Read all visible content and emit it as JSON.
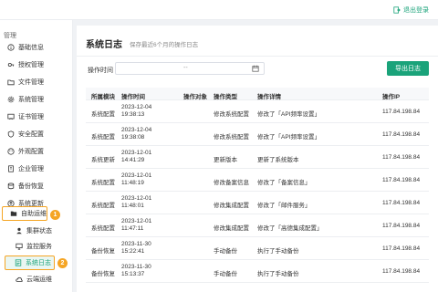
{
  "header": {
    "logout_label": "退出登录"
  },
  "sidebar": {
    "section_title": "管理",
    "items": [
      {
        "label": "基础信息",
        "icon": "info-icon"
      },
      {
        "label": "授权管理",
        "icon": "key-icon"
      },
      {
        "label": "文件管理",
        "icon": "folder-icon"
      },
      {
        "label": "系统管理",
        "icon": "gear-icon"
      },
      {
        "label": "证书管理",
        "icon": "certificate-icon"
      },
      {
        "label": "安全配置",
        "icon": "shield-icon"
      },
      {
        "label": "外观配置",
        "icon": "palette-icon"
      },
      {
        "label": "企业管理",
        "icon": "building-icon"
      },
      {
        "label": "备份恢复",
        "icon": "backup-icon"
      },
      {
        "label": "系统更新",
        "icon": "update-icon"
      },
      {
        "label": "自助运维",
        "icon": "folder-open-icon"
      }
    ],
    "subitems": [
      {
        "label": "集群状态",
        "icon": "cluster-icon"
      },
      {
        "label": "监控服务",
        "icon": "monitor-icon"
      },
      {
        "label": "系统日志",
        "icon": "log-icon"
      },
      {
        "label": "云端运维",
        "icon": "cloud-icon"
      }
    ],
    "badges": [
      "1",
      "2"
    ]
  },
  "main": {
    "title": "系统日志",
    "subtitle": "保存最近6个月的操作日志",
    "filter_label": "操作时间",
    "date_separator": "--",
    "export_label": "导出日志",
    "columns": [
      "所属模块",
      "操作时间",
      "操作对象",
      "操作类型",
      "操作详情",
      "操作IP"
    ],
    "rows": [
      {
        "module": "系统配置",
        "date": "2023-12-04",
        "time": "19:38:13",
        "object": "",
        "type": "修改系统配置",
        "detail": "修改了「API频率设置」",
        "ip": "117.84.198.84"
      },
      {
        "module": "系统配置",
        "date": "2023-12-04",
        "time": "19:38:08",
        "object": "",
        "type": "修改系统配置",
        "detail": "修改了「API频率设置」",
        "ip": "117.84.198.84"
      },
      {
        "module": "系统更新",
        "date": "2023-12-01",
        "time": "14:41:29",
        "object": "",
        "type": "更新版本",
        "detail": "更新了系统版本",
        "ip": "117.84.198.84"
      },
      {
        "module": "系统配置",
        "date": "2023-12-01",
        "time": "11:48:19",
        "object": "",
        "type": "修改备案信息",
        "detail": "修改了「备案信息」",
        "ip": "117.84.198.84"
      },
      {
        "module": "系统配置",
        "date": "2023-12-01",
        "time": "11:48:01",
        "object": "",
        "type": "修改集成配置",
        "detail": "修改了「邮件服务」",
        "ip": "117.84.198.84"
      },
      {
        "module": "系统配置",
        "date": "2023-12-01",
        "time": "11:47:11",
        "object": "",
        "type": "修改集成配置",
        "detail": "修改了「高德集成配置」",
        "ip": "117.84.198.84"
      },
      {
        "module": "备份恢复",
        "date": "2023-11-30",
        "time": "15:22:41",
        "object": "",
        "type": "手动备份",
        "detail": "执行了手动备份",
        "ip": "117.84.198.84"
      },
      {
        "module": "备份恢复",
        "date": "2023-11-30",
        "time": "15:13:37",
        "object": "",
        "type": "手动备份",
        "detail": "执行了手动备份",
        "ip": "117.84.198.84"
      }
    ]
  },
  "colors": {
    "accent": "#1aa37a",
    "highlight": "#f5a524"
  }
}
